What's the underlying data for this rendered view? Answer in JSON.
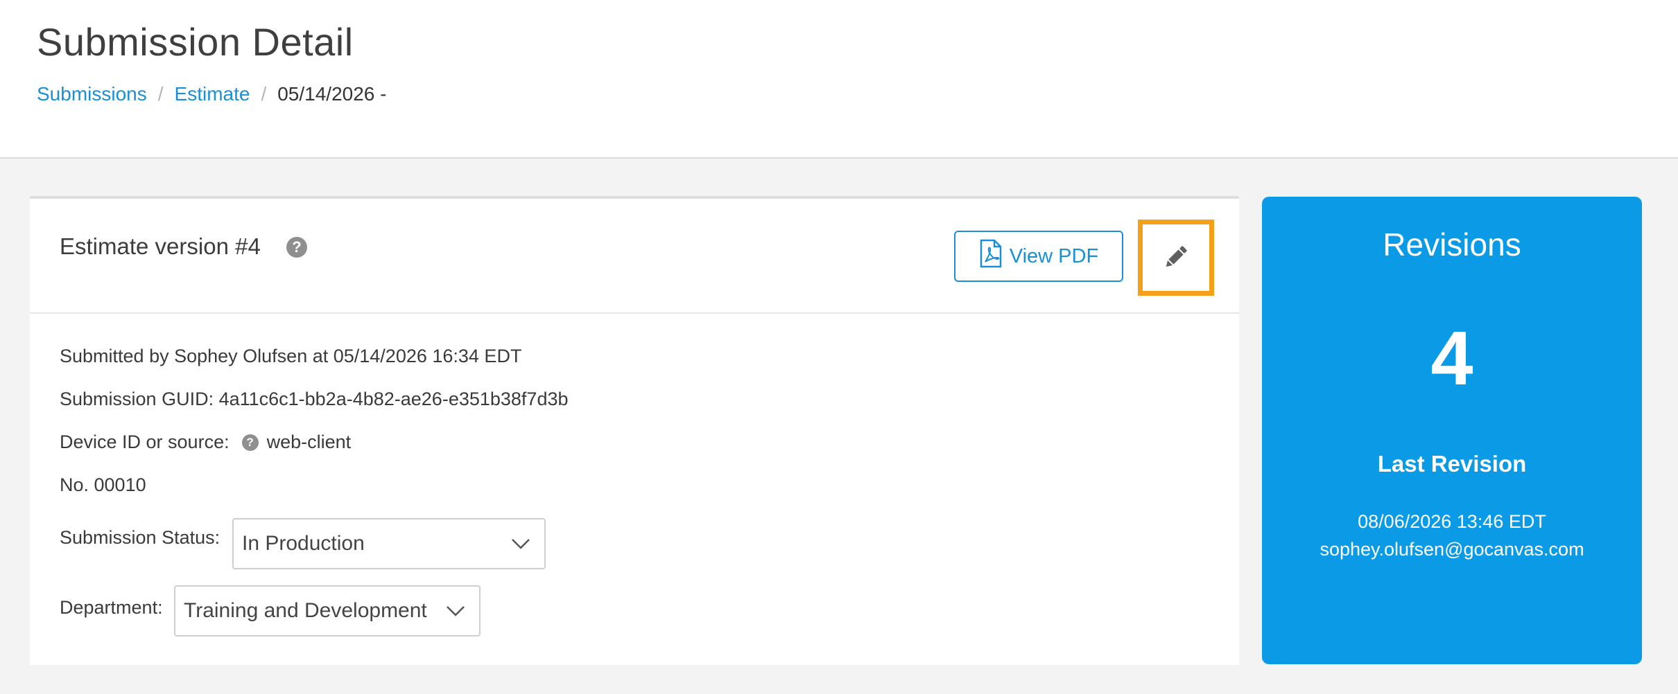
{
  "header": {
    "title": "Submission Detail",
    "breadcrumb": [
      {
        "label": "Submissions"
      },
      {
        "label": "Estimate"
      },
      {
        "label": "05/14/2026 -"
      }
    ],
    "separator": "/"
  },
  "card": {
    "title": "Estimate version #4",
    "help_icon": "?",
    "view_pdf_label": "View PDF",
    "edit_icon": "pencil-icon",
    "submitted_by": "Submitted by Sophey Olufsen at 05/14/2026 16:34 EDT",
    "guid": "Submission GUID: 4a11c6c1-bb2a-4b82-ae26-e351b38f7d3b",
    "device_label": "Device ID or source:",
    "device_value": "web-client",
    "number": "No. 00010",
    "status_label": "Submission Status:",
    "status_value": "In Production",
    "department_label": "Department:",
    "department_value": "Training and Development"
  },
  "revisions": {
    "title": "Revisions",
    "count": "4",
    "last_label": "Last Revision",
    "last_date": "08/06/2026 13:46 EDT",
    "last_user": "sophey.olufsen@gocanvas.com"
  },
  "colors": {
    "accent": "#1a8fd6",
    "revisions_bg": "#0b9be6",
    "highlight": "#f5a01a"
  }
}
